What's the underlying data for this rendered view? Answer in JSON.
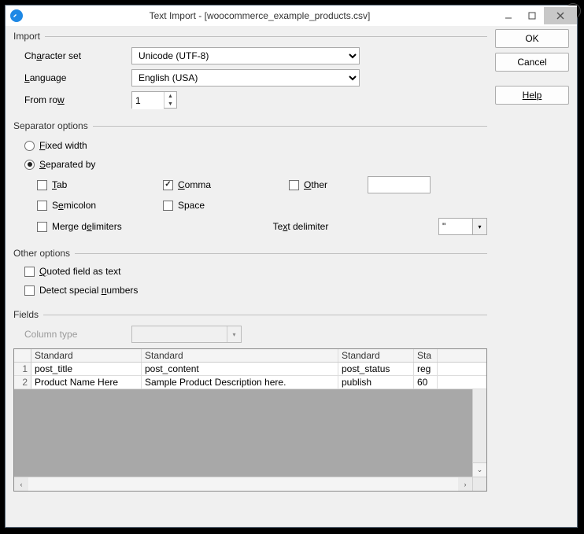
{
  "window": {
    "title": "Text Import - [woocommerce_example_products.csv]"
  },
  "buttons": {
    "ok": "OK",
    "cancel": "Cancel",
    "help": "Help"
  },
  "import": {
    "legend": "Import",
    "charset_label_pre": "Ch",
    "charset_label_u": "a",
    "charset_label_post": "racter set",
    "charset_value": "Unicode (UTF-8)",
    "lang_label_u": "L",
    "lang_label_post": "anguage",
    "lang_value": "English (USA)",
    "fromrow_label_pre": "From ro",
    "fromrow_label_u": "w",
    "fromrow_value": "1"
  },
  "sep": {
    "legend": "Separator options",
    "fixed_u": "F",
    "fixed_post": "ixed width",
    "separated_u": "S",
    "separated_post": "eparated by",
    "tab_u": "T",
    "tab_post": "ab",
    "comma_u": "C",
    "comma_post": "omma",
    "other_u": "O",
    "other_post": "ther",
    "semicolon_pre": "S",
    "semicolon_u": "e",
    "semicolon_post": "micolon",
    "space_label": "Space",
    "merge_label": "Merge d",
    "merge_u": "e",
    "merge_post": "limiters",
    "textdelim_pre": "Te",
    "textdelim_u": "x",
    "textdelim_post": "t delimiter",
    "textdelim_value": "\"",
    "checked": {
      "fixed": false,
      "separated": true,
      "tab": false,
      "comma": true,
      "other": false,
      "semicolon": false,
      "space": false,
      "merge": false
    }
  },
  "other": {
    "legend": "Other options",
    "quoted_u": "Q",
    "quoted_post": "uoted field as text",
    "detect_pre": "Detect special ",
    "detect_u": "n",
    "detect_post": "umbers"
  },
  "fields": {
    "legend": "Fields",
    "coltype_label": "Column type",
    "headers": [
      "Standard",
      "Standard",
      "Standard",
      "Sta"
    ],
    "rows": [
      {
        "n": "1",
        "cells": [
          "post_title",
          "post_content",
          "post_status",
          "reg"
        ]
      },
      {
        "n": "2",
        "cells": [
          "Product Name Here",
          "Sample Product Description here.",
          "publish",
          "60"
        ]
      }
    ]
  }
}
